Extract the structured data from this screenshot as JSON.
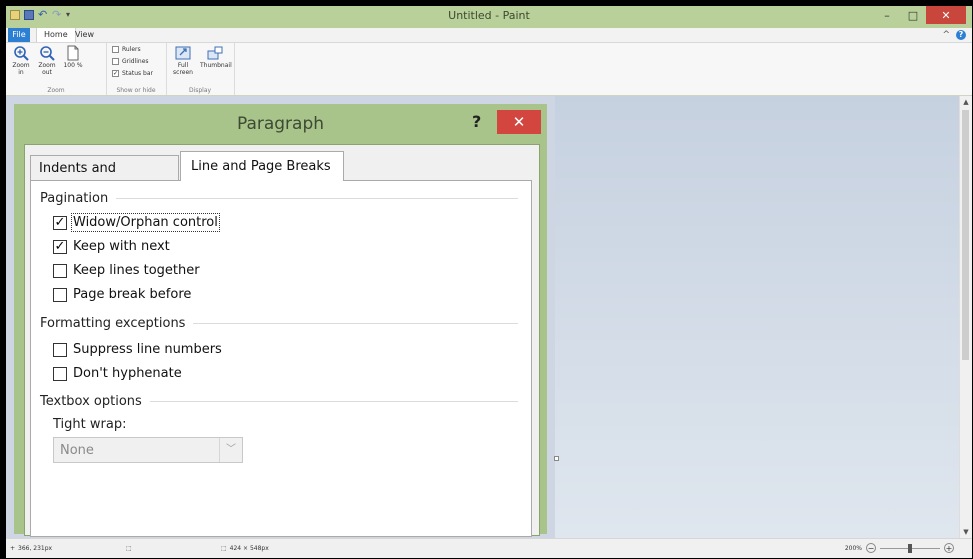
{
  "window": {
    "title": "Untitled - Paint",
    "minimize_glyph": "–",
    "maximize_glyph": "□",
    "close_glyph": "✕"
  },
  "quick_access": {
    "undo_glyph": "↶",
    "redo_glyph": "↷",
    "dropdown_glyph": "▾"
  },
  "ribbon": {
    "tabs": [
      "File",
      "Home",
      "View"
    ],
    "active_tab": "View",
    "collapse_glyph": "^",
    "help_glyph": "?",
    "zoom": {
      "group_label": "Zoom",
      "zoom_in": "Zoom in",
      "zoom_out": "Zoom out",
      "hundred": "100 %"
    },
    "show_hide": {
      "group_label": "Show or hide",
      "items": [
        {
          "label": "Rulers",
          "checked": false
        },
        {
          "label": "Gridlines",
          "checked": false
        },
        {
          "label": "Status bar",
          "checked": true
        }
      ]
    },
    "display": {
      "group_label": "Display",
      "full_screen": "Full screen",
      "thumbnail": "Thumbnail"
    }
  },
  "dialog": {
    "title": "Paragraph",
    "help_glyph": "?",
    "close_glyph": "✕",
    "tabs": [
      "Indents and Spacing",
      "Line and Page Breaks"
    ],
    "active_tab": "Line and Page Breaks",
    "pagination": {
      "heading": "Pagination",
      "options": [
        {
          "label": "Widow/Orphan control",
          "checked": true
        },
        {
          "label": "Keep with next",
          "checked": true
        },
        {
          "label": "Keep lines together",
          "checked": false
        },
        {
          "label": "Page break before",
          "checked": false
        }
      ]
    },
    "formatting_exceptions": {
      "heading": "Formatting exceptions",
      "options": [
        {
          "label": "Suppress line numbers",
          "checked": false
        },
        {
          "label": "Don't hyphenate",
          "checked": false
        }
      ]
    },
    "textbox_options": {
      "heading": "Textbox options",
      "tight_wrap_label": "Tight wrap:",
      "tight_wrap_value": "None"
    }
  },
  "statusbar": {
    "cursor_position": "366, 231px",
    "canvas_size": "424 × 548px",
    "zoom_level": "200%"
  }
}
